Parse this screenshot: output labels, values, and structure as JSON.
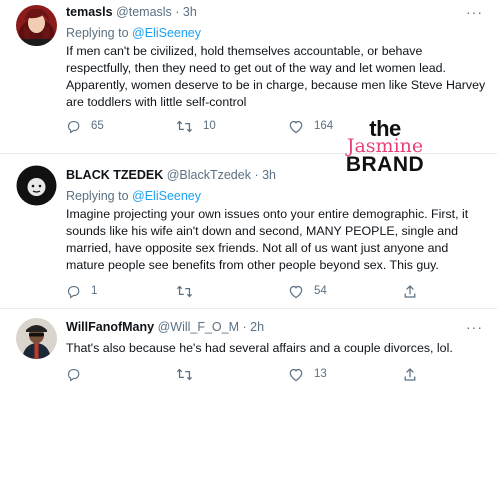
{
  "tweets": [
    {
      "name": "temasls",
      "handle": "@temasls",
      "time": "· 3h",
      "reply_prefix": "Replying to",
      "reply_to": "@EliSeeney",
      "text_lines": [
        "If men can't be civilized, hold themselves accountable, or behave",
        "respectfully, then they need to get out of the way and let women lead.",
        "Apparently, women deserve to be in charge, because men like Steve Harvey",
        "are toddlers with little self-control"
      ],
      "replies": "65",
      "retweets": "10",
      "likes": "164"
    },
    {
      "name": "BLACK TZEDEK",
      "handle": "@BlackTzedek",
      "time": "· 3h",
      "reply_prefix": "Replying to",
      "reply_to": "@EliSeeney",
      "text_lines": [
        "Imagine projecting your own issues onto your entire demographic. First, it",
        "sounds like his wife ain't down and second, MANY PEOPLE, single and",
        "married, have opposite sex friends. Not all of us want just anyone and",
        "mature people see benefits from other people beyond sex. This guy."
      ],
      "replies": "1",
      "retweets": "",
      "likes": "54"
    },
    {
      "name": "WillFanofMany",
      "handle": "@Will_F_O_M",
      "time": "· 2h",
      "text_lines": [
        "That's also because he's had several affairs and a couple divorces, lol."
      ],
      "replies": "",
      "retweets": "",
      "likes": "13"
    }
  ],
  "more_glyph": "···",
  "watermark": {
    "line1": "the",
    "line2": "Jasmine",
    "line3": "BRAND"
  },
  "colors": {
    "accent": "#1da1f2",
    "secondary_text": "#5b7083",
    "watermark_pink": "#e8417a"
  },
  "icons": [
    "reply-icon",
    "retweet-icon",
    "like-icon",
    "share-icon",
    "more-icon"
  ]
}
